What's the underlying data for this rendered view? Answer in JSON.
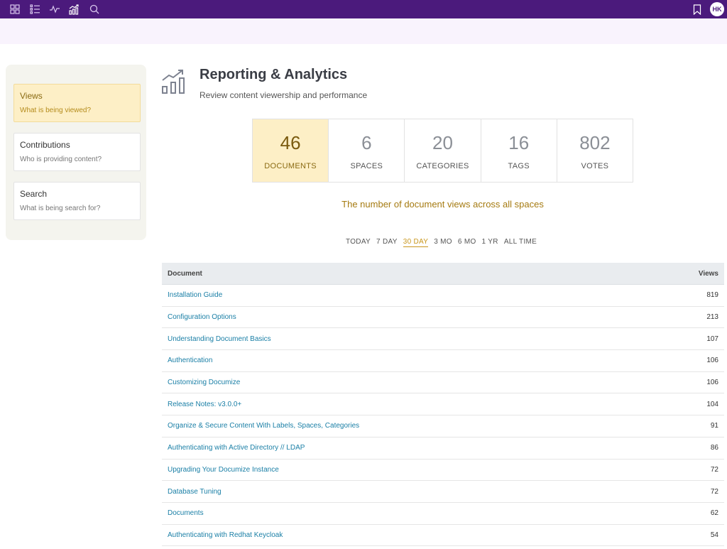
{
  "topbar": {
    "nav_icons": [
      "grid-icon",
      "list-icon",
      "activity-icon",
      "analytics-icon",
      "search-icon"
    ],
    "bookmark_icon": "bookmark-icon",
    "avatar_initials": "HK",
    "bg_color": "#4b1a7c"
  },
  "sidebar": {
    "items": [
      {
        "title": "Views",
        "subtitle": "What is being viewed?",
        "active": true
      },
      {
        "title": "Contributions",
        "subtitle": "Who is providing content?",
        "active": false
      },
      {
        "title": "Search",
        "subtitle": "What is being search for?",
        "active": false
      }
    ]
  },
  "header": {
    "title": "Reporting & Analytics",
    "subtitle": "Review content viewership and performance"
  },
  "stats": [
    {
      "value": "46",
      "label": "DOCUMENTS",
      "active": true
    },
    {
      "value": "6",
      "label": "SPACES",
      "active": false
    },
    {
      "value": "20",
      "label": "CATEGORIES",
      "active": false
    },
    {
      "value": "16",
      "label": "TAGS",
      "active": false
    },
    {
      "value": "802",
      "label": "VOTES",
      "active": false
    }
  ],
  "stat_description": "The number of document views across all spaces",
  "periods": [
    {
      "label": "TODAY",
      "active": false
    },
    {
      "label": "7 DAY",
      "active": false
    },
    {
      "label": "30 DAY",
      "active": true
    },
    {
      "label": "3 MO",
      "active": false
    },
    {
      "label": "6 MO",
      "active": false
    },
    {
      "label": "1 YR",
      "active": false
    },
    {
      "label": "ALL TIME",
      "active": false
    }
  ],
  "table": {
    "headers": {
      "document": "Document",
      "views": "Views"
    },
    "rows": [
      {
        "document": "Installation Guide",
        "views": "819"
      },
      {
        "document": "Configuration Options",
        "views": "213"
      },
      {
        "document": "Understanding Document Basics",
        "views": "107"
      },
      {
        "document": "Authentication",
        "views": "106"
      },
      {
        "document": "Customizing Documize",
        "views": "106"
      },
      {
        "document": "Release Notes: v3.0.0+",
        "views": "104"
      },
      {
        "document": "Organize & Secure Content With Labels, Spaces, Categories",
        "views": "91"
      },
      {
        "document": "Authenticating with Active Directory // LDAP",
        "views": "86"
      },
      {
        "document": "Upgrading Your Documize Instance",
        "views": "72"
      },
      {
        "document": "Database Tuning",
        "views": "72"
      },
      {
        "document": "Documents",
        "views": "62"
      },
      {
        "document": "Authenticating with Redhat Keycloak",
        "views": "54"
      }
    ]
  }
}
